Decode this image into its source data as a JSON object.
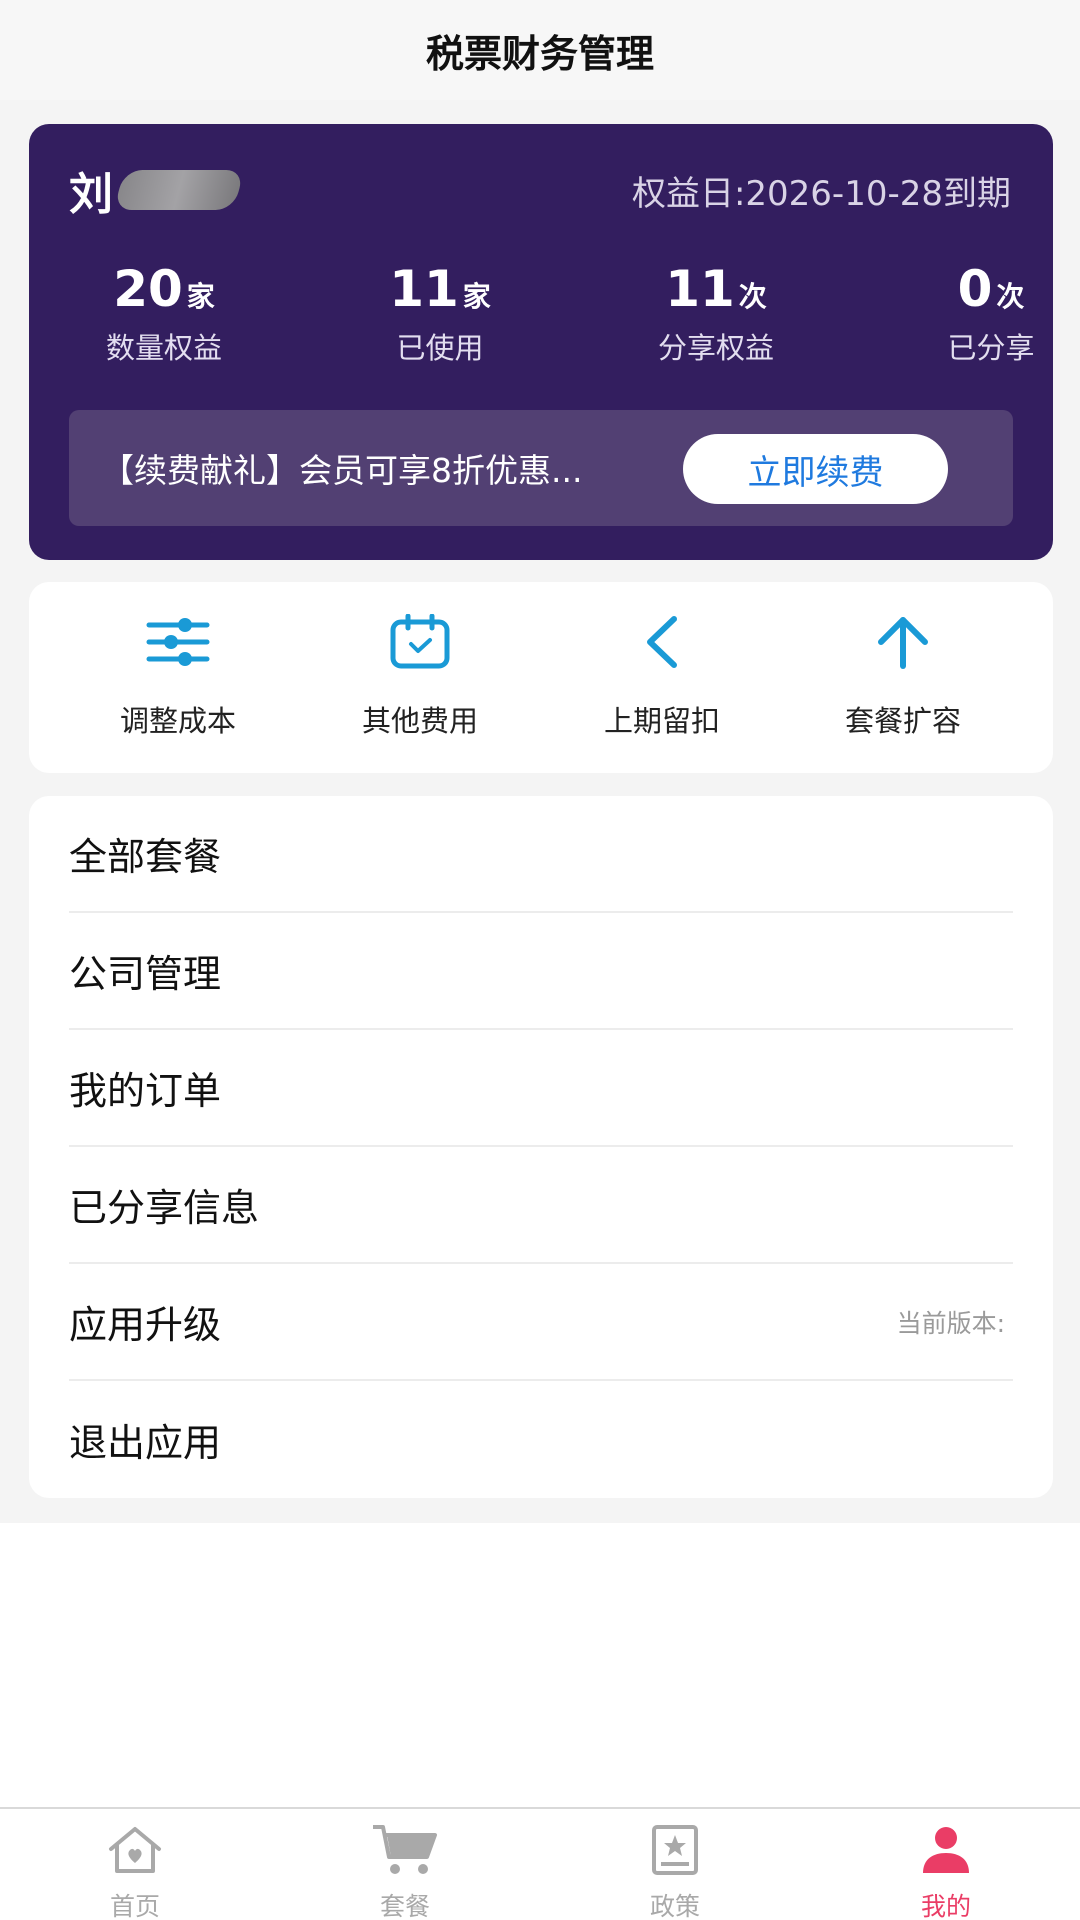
{
  "header": {
    "title": "税票财务管理"
  },
  "member_card": {
    "name": "刘",
    "expiry": "权益日:2026-10-28到期",
    "stats": [
      {
        "value": "20",
        "unit": "家",
        "label": "数量权益"
      },
      {
        "value": "11",
        "unit": "家",
        "label": "已使用"
      },
      {
        "value": "11",
        "unit": "次",
        "label": "分享权益"
      },
      {
        "value": "0",
        "unit": "次",
        "label": "已分享"
      }
    ],
    "promo": {
      "text": "【续费献礼】会员可享8折优惠...",
      "button": "立即续费"
    }
  },
  "quick_actions": [
    {
      "label": "调整成本",
      "icon": "sliders-icon"
    },
    {
      "label": "其他费用",
      "icon": "calendar-check-icon"
    },
    {
      "label": "上期留扣",
      "icon": "chevron-left-icon"
    },
    {
      "label": "套餐扩容",
      "icon": "arrow-up-icon"
    }
  ],
  "menu": [
    {
      "label": "全部套餐"
    },
    {
      "label": "公司管理"
    },
    {
      "label": "我的订单"
    },
    {
      "label": "已分享信息"
    },
    {
      "label": "应用升级",
      "note": "当前版本:"
    },
    {
      "label": "退出应用"
    }
  ],
  "tabbar": [
    {
      "label": "首页",
      "icon": "home-heart-icon"
    },
    {
      "label": "套餐",
      "icon": "cart-icon"
    },
    {
      "label": "政策",
      "icon": "policy-book-icon"
    },
    {
      "label": "我的",
      "icon": "user-icon",
      "active": true
    }
  ],
  "colors": {
    "card_bg": "#331e5f",
    "promo_bg": "#524073",
    "accent_blue": "#1a9ad6",
    "button_text": "#1f7adf",
    "tab_active": "#ea3d66",
    "tab_inactive": "#a9a9a9"
  }
}
